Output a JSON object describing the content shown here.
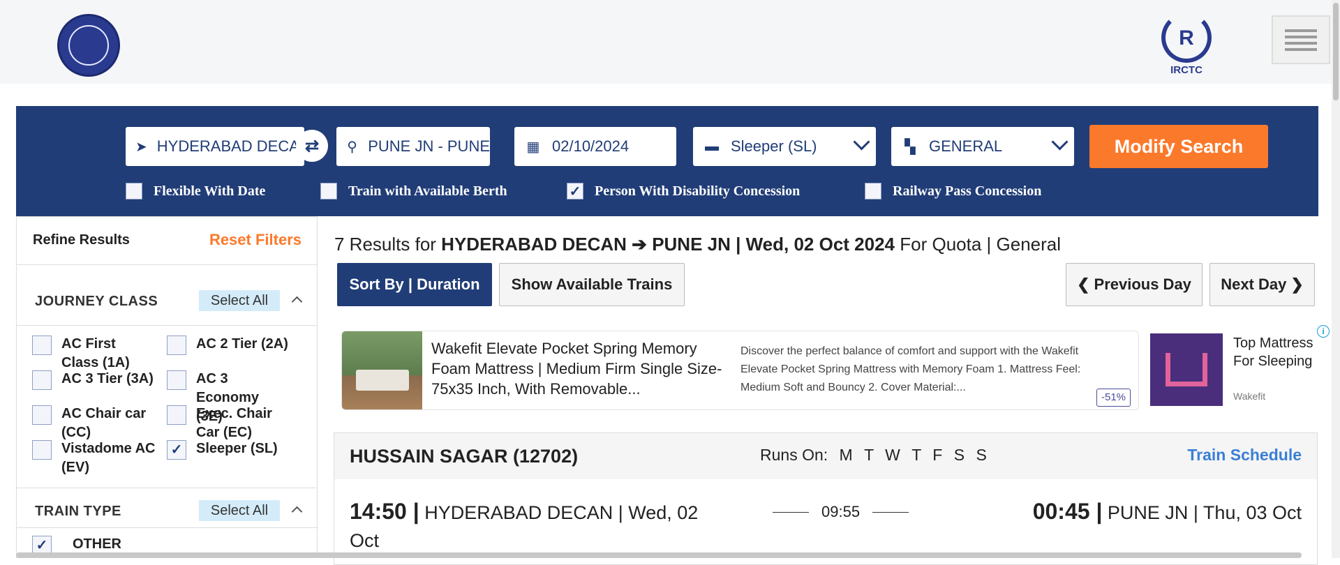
{
  "header": {
    "logo_left": "Indian Railways",
    "logo_right_text": "IRCTC"
  },
  "search": {
    "from": "HYDERABAD DECAN",
    "to": "PUNE JN - PUNE",
    "date": "02/10/2024",
    "class": "Sleeper (SL)",
    "quota": "GENERAL",
    "modify_label": "Modify Search",
    "options": [
      {
        "label": "Flexible With Date",
        "checked": false
      },
      {
        "label": "Train with Available Berth",
        "checked": false
      },
      {
        "label": "Person With Disability Concession",
        "checked": true
      },
      {
        "label": "Railway Pass Concession",
        "checked": false
      }
    ]
  },
  "sidebar": {
    "title": "Refine Results",
    "reset": "Reset Filters",
    "journey_class_title": "JOURNEY CLASS",
    "select_all": "Select All",
    "classes": [
      {
        "label": "AC First Class (1A)",
        "checked": false
      },
      {
        "label": "AC 2 Tier (2A)",
        "checked": false
      },
      {
        "label": "AC 3 Tier (3A)",
        "checked": false
      },
      {
        "label": "AC 3 Economy (3E)",
        "checked": false
      },
      {
        "label": "AC Chair car (CC)",
        "checked": false
      },
      {
        "label": "Exec. Chair Car (EC)",
        "checked": false
      },
      {
        "label": "Vistadome AC (EV)",
        "checked": false
      },
      {
        "label": "Sleeper (SL)",
        "checked": true
      }
    ],
    "train_type_title": "TRAIN TYPE",
    "train_types": [
      {
        "label": "OTHER",
        "checked": true
      }
    ]
  },
  "results": {
    "count_text": "7 Results for ",
    "route": "HYDERABAD DECAN ➔ PUNE JN | Wed, 02 Oct 2024",
    "quota_text": " For Quota | General",
    "sort_label": "Sort By | Duration",
    "available_label": "Show Available Trains",
    "prev_label": "Previous Day",
    "next_label": "Next Day"
  },
  "ad": {
    "title": "Wakefit Elevate Pocket Spring Memory Foam Mattress | Medium Firm Single Size-75x35 Inch, With Removable...",
    "description": "Discover the perfect balance of comfort and support with the Wakefit Elevate Pocket Spring Mattress with Memory Foam 1. Mattress Feel: Medium Soft and Bouncy 2. Cover Material:...",
    "discount": "-51%",
    "side_title": "Top Mattress For Sleeping",
    "side_brand": "Wakefit"
  },
  "train": {
    "name": "HUSSAIN SAGAR (12702)",
    "runs_on_label": "Runs On:",
    "days": [
      "M",
      "T",
      "W",
      "T",
      "F",
      "S",
      "S"
    ],
    "schedule_label": "Train Schedule",
    "dep_time": "14:50",
    "dep_station": " HYDERABAD DECAN | Wed, 02 Oct",
    "duration": "09:55",
    "arr_time": "00:45",
    "arr_station": " PUNE JN | Thu, 03 Oct"
  }
}
